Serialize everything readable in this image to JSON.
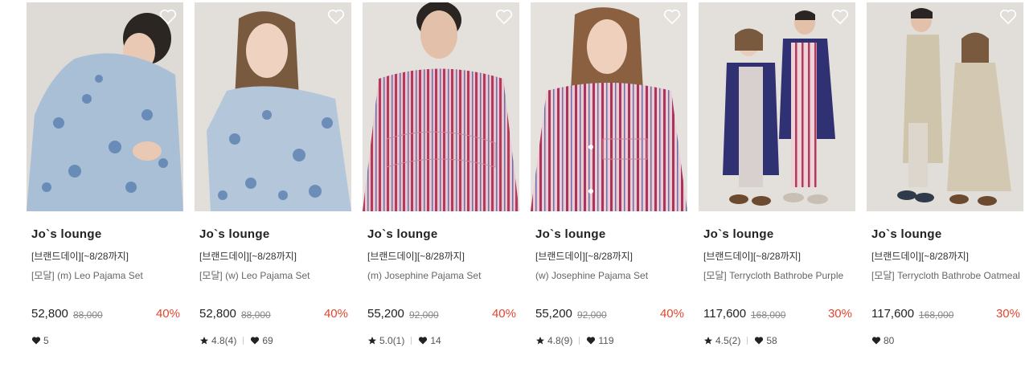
{
  "products": [
    {
      "brand": "Jo`s lounge",
      "promo": "[브랜드데이][~8/28까지]",
      "name": "[모달] (m) Leo Pajama Set",
      "price": "52,800",
      "original_price": "88,000",
      "discount": "40%",
      "rating": "",
      "likes": "5",
      "image_colors": {
        "bg": "#dedad5",
        "garment": "#a9bfd6",
        "accent": "#5a7fb0"
      }
    },
    {
      "brand": "Jo`s lounge",
      "promo": "[브랜드데이][~8/28까지]",
      "name": "[모달] (w) Leo Pajama Set",
      "price": "52,800",
      "original_price": "88,000",
      "discount": "40%",
      "rating": "4.8(4)",
      "likes": "69",
      "image_colors": {
        "bg": "#e2ded9",
        "garment": "#b3c6da",
        "accent": "#5a7fb0"
      }
    },
    {
      "brand": "Jo`s lounge",
      "promo": "[브랜드데이][~8/28까지]",
      "name": "(m) Josephine Pajama Set",
      "price": "55,200",
      "original_price": "92,000",
      "discount": "40%",
      "rating": "5.0(1)",
      "likes": "14",
      "image_colors": {
        "bg": "#e4e0db",
        "garment": "#d8a7b4",
        "accent": "#b5395a"
      }
    },
    {
      "brand": "Jo`s lounge",
      "promo": "[브랜드데이][~8/28까지]",
      "name": "(w) Josephine Pajama Set",
      "price": "55,200",
      "original_price": "92,000",
      "discount": "40%",
      "rating": "4.8(9)",
      "likes": "119",
      "image_colors": {
        "bg": "#e5e1dc",
        "garment": "#d9a3b4",
        "accent": "#a9365a"
      }
    },
    {
      "brand": "Jo`s lounge",
      "promo": "[브랜드데이][~8/28까지]",
      "name": "[모달] Terrycloth Bathrobe Purple",
      "price": "117,600",
      "original_price": "168,000",
      "discount": "30%",
      "rating": "4.5(2)",
      "likes": "58",
      "image_colors": {
        "bg": "#e3dfda",
        "garment": "#2f3173",
        "accent": "#d0a0b0"
      }
    },
    {
      "brand": "Jo`s lounge",
      "promo": "[브랜드데이][~8/28까지]",
      "name": "[모달] Terrycloth Bathrobe Oatmeal",
      "price": "117,600",
      "original_price": "168,000",
      "discount": "30%",
      "rating": "",
      "likes": "80",
      "image_colors": {
        "bg": "#e1ddd8",
        "garment": "#cfc4ac",
        "accent": "#2f3a4a"
      }
    }
  ],
  "colors": {
    "discount": "#e4452f",
    "price": "#222222",
    "muted": "#888888"
  },
  "icons": {
    "wishlist": "heart-outline-icon",
    "rating": "star-icon",
    "likes": "heart-filled-icon"
  }
}
